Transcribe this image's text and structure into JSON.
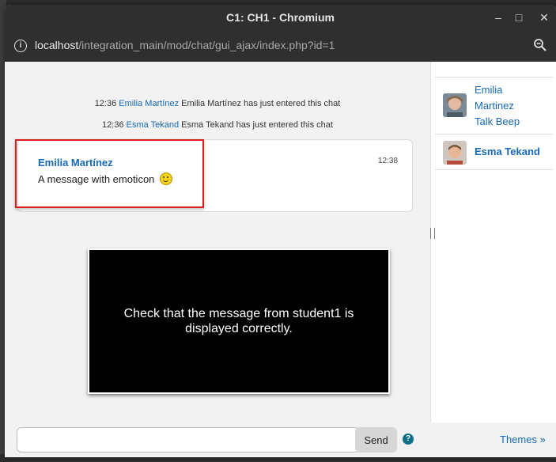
{
  "window": {
    "title": "C1: CH1 - Chromium",
    "minimize_glyph": "–",
    "maximize_glyph": "□",
    "close_glyph": "✕"
  },
  "addressbar": {
    "info_icon": "info-icon",
    "info_glyph": "i",
    "host": "localhost",
    "path": "/integration_main/mod/chat/gui_ajax/index.php?id=1",
    "zoom_icon": "zoom-icon"
  },
  "system_messages": [
    {
      "time": "12:36",
      "user": "Emilia Martínez",
      "text": "Emilia Martínez has just entered this chat"
    },
    {
      "time": "12:36",
      "user": "Esma Tekand",
      "text": "Esma Tekand has just entered this chat"
    }
  ],
  "message": {
    "author": "Emilia Martínez",
    "text": "A message with emoticon",
    "time": "12:38",
    "emoticon": "smiley-icon"
  },
  "overlay": {
    "text": "Check that the message from student1 is displayed correctly."
  },
  "users": [
    {
      "name_line1": "Emilia",
      "name_line2": "Martinez",
      "name_line3": "Talk Beep"
    },
    {
      "name": "Esma Tekand"
    }
  ],
  "input": {
    "value": "",
    "placeholder": ""
  },
  "send_label": "Send",
  "help_glyph": "?",
  "themes_label": "Themes »",
  "colors": {
    "link": "#1669b8",
    "highlight_border": "#d81e1e",
    "help_icon": "#0f6f8a"
  }
}
